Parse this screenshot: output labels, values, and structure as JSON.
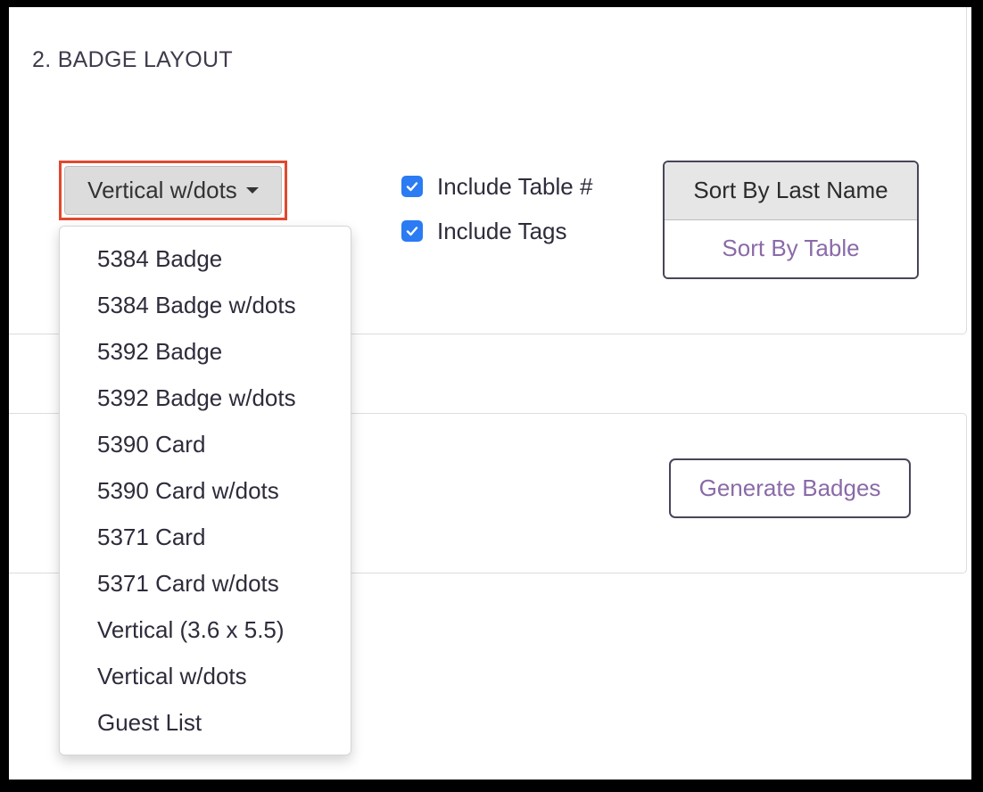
{
  "section": {
    "title": "2. BADGE LAYOUT"
  },
  "layout_dropdown": {
    "selected": "Vertical w/dots",
    "options": [
      "5384 Badge",
      "5384 Badge w/dots",
      "5392 Badge",
      "5392 Badge w/dots",
      "5390 Card",
      "5390 Card w/dots",
      "5371 Card",
      "5371 Card w/dots",
      "Vertical (3.6 x 5.5)",
      "Vertical w/dots",
      "Guest List"
    ]
  },
  "options": {
    "include_table": {
      "label": "Include Table #",
      "checked": true
    },
    "include_tags": {
      "label": "Include Tags",
      "checked": true
    }
  },
  "sort": {
    "by_last_name": "Sort By Last Name",
    "by_table": "Sort By Table",
    "active": "by_last_name"
  },
  "actions": {
    "generate": "Generate Badges"
  },
  "colors": {
    "highlight_border": "#e0492e",
    "checkbox": "#2b7bf3",
    "accent_text": "#8a6aa8",
    "border_dark": "#4a4458"
  }
}
